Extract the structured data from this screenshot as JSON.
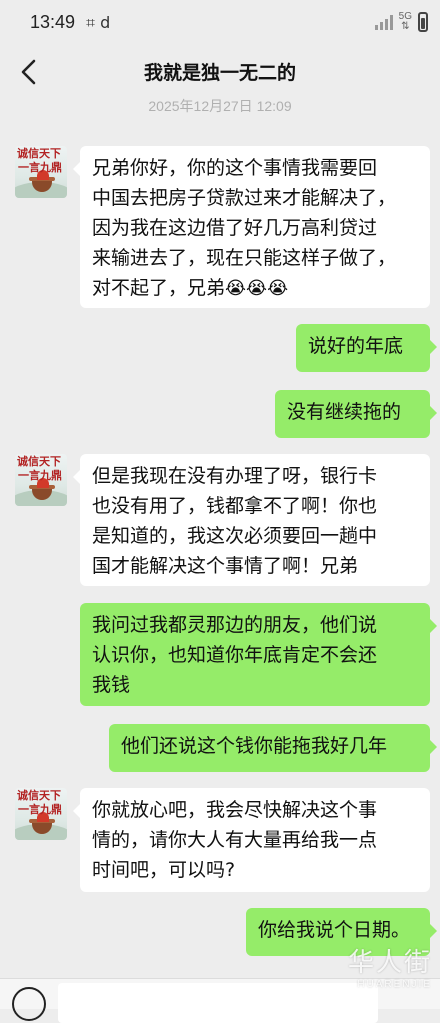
{
  "status_bar": {
    "time": "13:49",
    "left_icons": "⌗ d",
    "network": "5G"
  },
  "header": {
    "title": "我就是独一无二的"
  },
  "chat": {
    "timestamp": "2025年12月27日 12:09",
    "contact_avatar_text": [
      "诚信天下",
      "一言九鼎"
    ],
    "messages": [
      {
        "side": "left",
        "lines": [
          "兄弟你好，你的这个事情我需要回",
          "中国去把房子贷款过来才能解决了，",
          "因为我在这边借了好几万高利贷过",
          "来输进去了，现在只能这样子做了，",
          "对不起了，兄弟"
        ],
        "emoji": "😭😭😭"
      },
      {
        "side": "right",
        "lines": [
          "说好的年底"
        ]
      },
      {
        "side": "right",
        "lines": [
          "没有继续拖的"
        ]
      },
      {
        "side": "left",
        "lines": [
          "但是我现在没有办理了呀，银行卡",
          "也没有用了，钱都拿不了啊！你也",
          "是知道的，我这次必须要回一趟中",
          "国才能解决这个事情了啊！兄弟"
        ]
      },
      {
        "side": "right",
        "lines": [
          "我问过我都灵那边的朋友，他们说",
          "认识你，也知道你年底肯定不会还",
          "我钱"
        ]
      },
      {
        "side": "right",
        "lines": [
          "他们还说这个钱你能拖我好几年"
        ]
      },
      {
        "side": "left",
        "lines": [
          "你就放心吧，我会尽快解决这个事",
          "情的，请你大人有大量再给我一点",
          "时间吧，可以吗?"
        ]
      },
      {
        "side": "right",
        "lines": [
          "你给我说个日期。"
        ]
      }
    ]
  },
  "watermark": {
    "logo": "华人街",
    "domain": "HUARENJIE"
  },
  "icons": {
    "back": "chevron-left-icon",
    "voice": "voice-icon"
  }
}
